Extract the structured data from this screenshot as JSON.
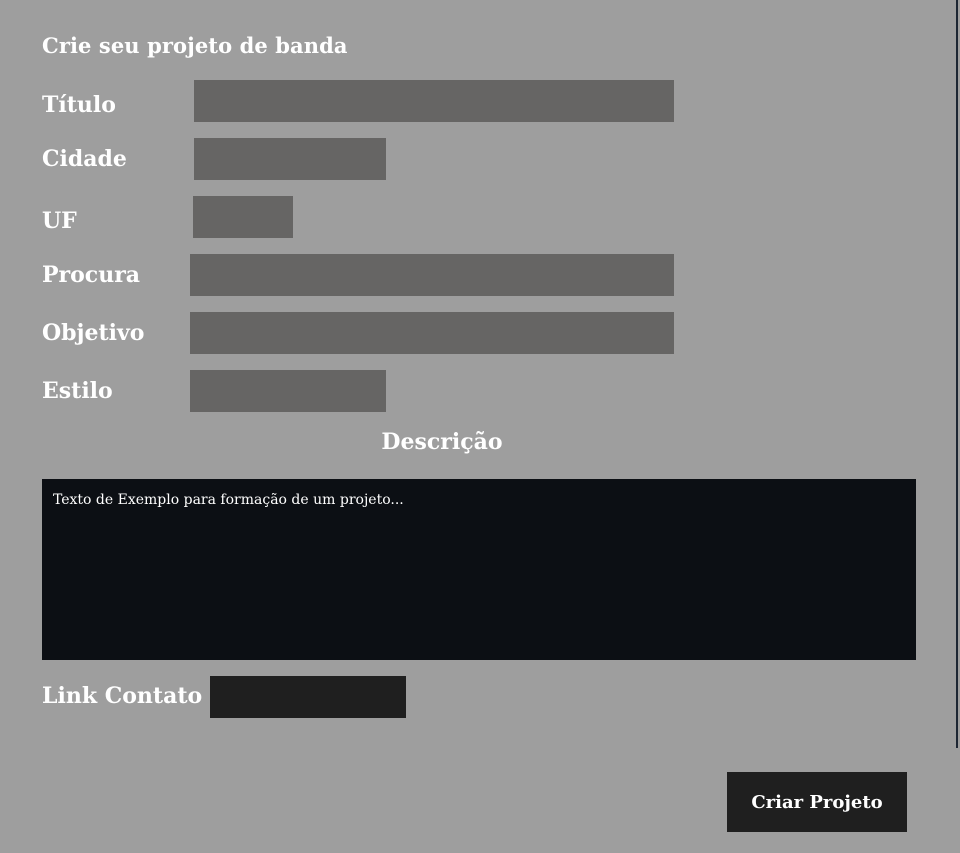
{
  "form": {
    "title": "Crie seu projeto de banda",
    "fields": {
      "titulo": {
        "label": "Título",
        "value": ""
      },
      "cidade": {
        "label": "Cidade",
        "value": ""
      },
      "uf": {
        "label": "UF",
        "value": ""
      },
      "procura": {
        "label": "Procura",
        "value": ""
      },
      "objetivo": {
        "label": "Objetivo",
        "value": ""
      },
      "estilo": {
        "label": "Estilo",
        "value": ""
      }
    },
    "descricao": {
      "label": "Descrição",
      "value": "Texto de Exemplo para formação de um projeto..."
    },
    "link_contato": {
      "label": "Link Contato",
      "value": ""
    },
    "submit_label": "Criar Projeto"
  },
  "colors": {
    "background": "#9e9e9e",
    "input_fill": "#666564",
    "textarea_fill": "#0c0f14",
    "dark_fill": "#1f1f1f",
    "text": "#ffffff"
  }
}
